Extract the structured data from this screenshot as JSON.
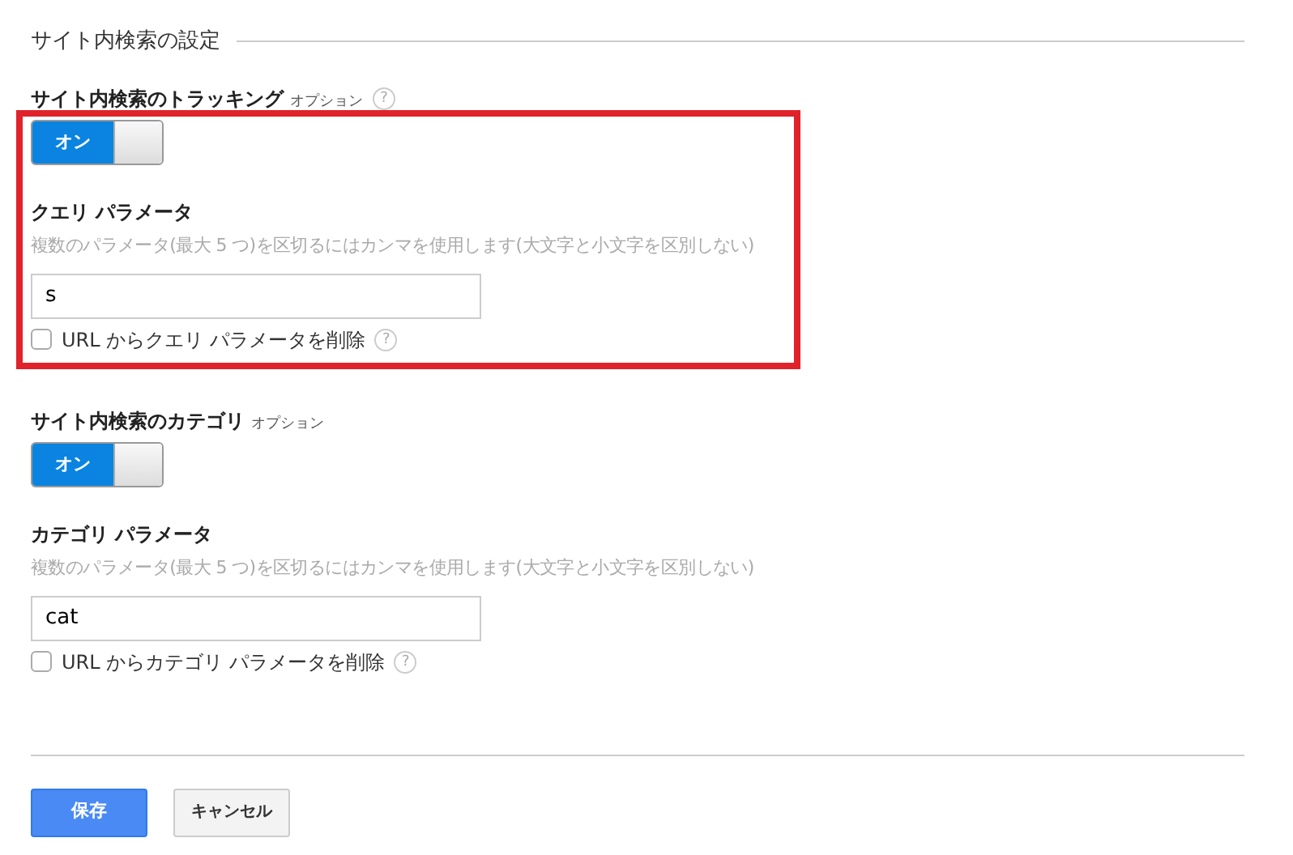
{
  "title": "サイト内検索の設定",
  "sections": [
    {
      "label": "サイト内検索のトラッキング",
      "optional": "オプション",
      "help": "?",
      "toggle": {
        "label": "オン",
        "on": true
      },
      "param_label": "クエリ パラメータ",
      "hint": "複数のパラメータ(最大 5 つ)を区切るにはカンマを使用します(大文字と小文字を区別しない)",
      "value": "s",
      "checkbox": {
        "label": "URL からクエリ パラメータを削除",
        "checked": false,
        "help": "?"
      },
      "highlighted": true
    },
    {
      "label": "サイト内検索のカテゴリ",
      "optional": "オプション",
      "toggle": {
        "label": "オン",
        "on": true
      },
      "param_label": "カテゴリ パラメータ",
      "hint": "複数のパラメータ(最大 5 つ)を区切るにはカンマを使用します(大文字と小文字を区別しない)",
      "value": "cat",
      "checkbox": {
        "label": "URL からカテゴリ パラメータを削除",
        "checked": false,
        "help": "?"
      },
      "highlighted": false
    }
  ],
  "buttons": [
    {
      "label": "保存",
      "kind": "primary"
    },
    {
      "label": "キャンセル",
      "kind": "secondary"
    }
  ]
}
